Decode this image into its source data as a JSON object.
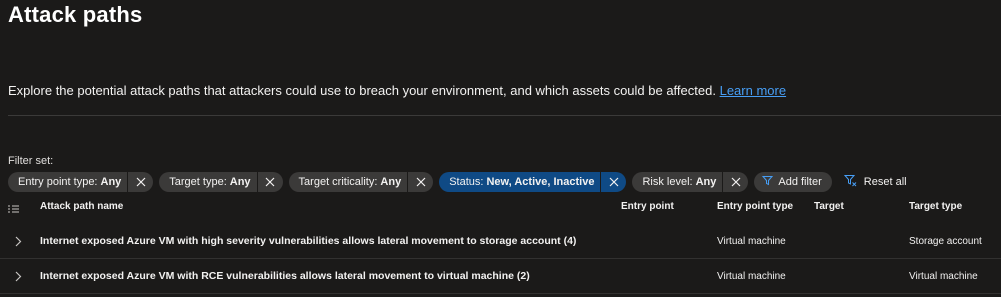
{
  "page": {
    "title": "Attack paths",
    "description": "Explore the potential attack paths that attackers could use to breach your environment, and which assets could be affected.",
    "learn_more": "Learn more"
  },
  "filters": {
    "label": "Filter set:",
    "pills": [
      {
        "key": "Entry point type:",
        "value": "Any"
      },
      {
        "key": "Target type:",
        "value": "Any"
      },
      {
        "key": "Target criticality:",
        "value": "Any"
      },
      {
        "key": "Status:",
        "value": "New, Active, Inactive"
      },
      {
        "key": "Risk level:",
        "value": "Any"
      }
    ],
    "add_filter": "Add filter",
    "reset_all": "Reset all",
    "colors": {
      "active_pill": "#0f4a85",
      "pill": "#3b3a39",
      "link": "#479ef5"
    }
  },
  "table": {
    "columns": {
      "name": "Attack path name",
      "entry_point": "Entry point",
      "entry_point_type": "Entry point type",
      "target": "Target",
      "target_type": "Target type"
    },
    "rows": [
      {
        "name": "Internet exposed Azure VM with high severity vulnerabilities allows lateral movement to storage account (4)",
        "entry_point": "",
        "entry_point_type": "Virtual machine",
        "target": "",
        "target_type": "Storage account"
      },
      {
        "name": "Internet exposed Azure VM with RCE vulnerabilities allows lateral movement to virtual machine (2)",
        "entry_point": "",
        "entry_point_type": "Virtual machine",
        "target": "",
        "target_type": "Virtual machine"
      }
    ]
  },
  "icons": [
    "close-icon",
    "filter-icon",
    "filter-reset-icon",
    "columns-icon",
    "chevron-right-icon"
  ]
}
